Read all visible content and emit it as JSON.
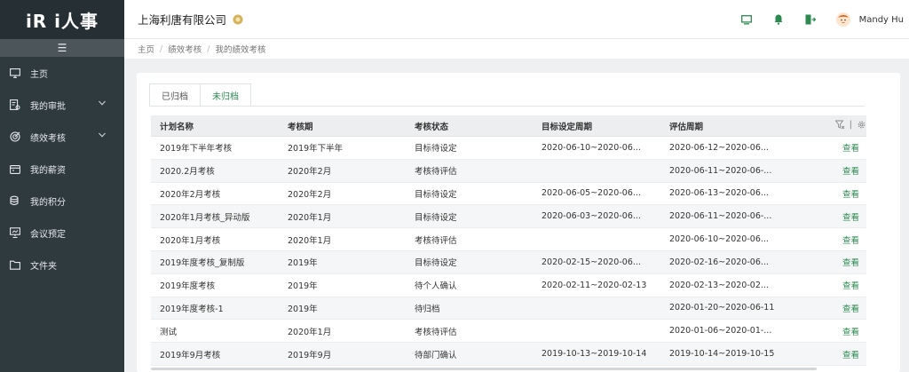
{
  "app": {
    "logo_text": "iR i人事",
    "company": "上海利唐有限公司",
    "user_name": "Mandy Hu"
  },
  "sidebar": {
    "items": [
      {
        "label": "主页",
        "icon": "monitor-icon",
        "expandable": false
      },
      {
        "label": "我的审批",
        "icon": "approval-icon",
        "expandable": true
      },
      {
        "label": "绩效考核",
        "icon": "target-icon",
        "expandable": true
      },
      {
        "label": "我的薪资",
        "icon": "wallet-icon",
        "expandable": false
      },
      {
        "label": "我的积分",
        "icon": "coins-icon",
        "expandable": false
      },
      {
        "label": "会议预定",
        "icon": "presentation-icon",
        "expandable": false
      },
      {
        "label": "文件夹",
        "icon": "folder-icon",
        "expandable": false
      }
    ]
  },
  "header": {
    "icons": [
      "screen-icon",
      "bell-icon",
      "logout-icon"
    ],
    "accent": "#2c8a50"
  },
  "breadcrumb": [
    "主页",
    "绩效考核",
    "我的绩效考核"
  ],
  "tabs": [
    {
      "label": "已归档",
      "active": false
    },
    {
      "label": "未归档",
      "active": true
    }
  ],
  "table": {
    "columns": [
      "计划名称",
      "考核期",
      "考核状态",
      "目标设定周期",
      "评估周期"
    ],
    "action_label": "查看",
    "rows": [
      [
        "2019年下半年考核",
        "2019年下半年",
        "目标待设定",
        "2020-06-10~2020-06...",
        "2020-06-12~2020-06..."
      ],
      [
        "2020.2月考核",
        "2020年2月",
        "考核待评估",
        "",
        "2020-06-11~2020-06-..."
      ],
      [
        "2020年2月考核",
        "2020年2月",
        "目标待设定",
        "2020-06-05~2020-06...",
        "2020-06-13~2020-06..."
      ],
      [
        "2020年1月考核_异动版",
        "2020年1月",
        "目标待设定",
        "2020-06-03~2020-06...",
        "2020-06-11~2020-06-..."
      ],
      [
        "2020年1月考核",
        "2020年1月",
        "考核待评估",
        "",
        "2020-06-10~2020-06..."
      ],
      [
        "2019年度考核_复制版",
        "2019年",
        "目标待设定",
        "2020-02-15~2020-06...",
        "2020-02-16~2020-06..."
      ],
      [
        "2019年度考核",
        "2019年",
        "待个人确认",
        "2020-02-11~2020-02-13",
        "2020-02-13~2020-02..."
      ],
      [
        "2019年度考核-1",
        "2019年",
        "待归档",
        "",
        "2020-01-20~2020-06-11"
      ],
      [
        "测试",
        "2020年1月",
        "考核待评估",
        "",
        "2020-01-06~2020-01-..."
      ],
      [
        "2019年9月考核",
        "2019年9月",
        "待部门确认",
        "2019-10-13~2019-10-14",
        "2019-10-14~2019-10-15"
      ]
    ]
  }
}
